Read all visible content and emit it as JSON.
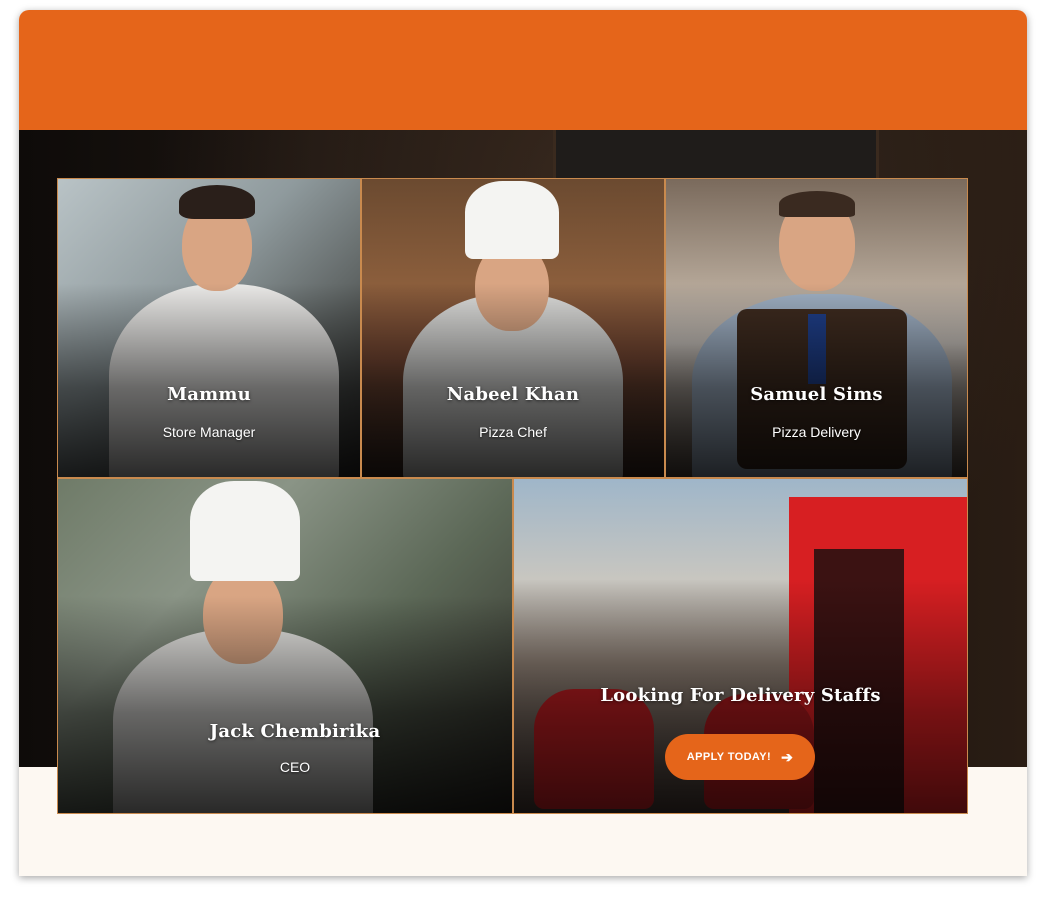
{
  "team": [
    {
      "name": "Mammu",
      "role": "Store Manager"
    },
    {
      "name": "Nabeel Khan",
      "role": "Pizza Chef"
    },
    {
      "name": "Samuel Sims",
      "role": "Pizza Delivery"
    },
    {
      "name": "Jack Chembirika",
      "role": "CEO"
    }
  ],
  "recruit": {
    "title": "Looking For Delivery Staffs",
    "button_label": "APPLY TODAY!",
    "button_icon": "arrow-right-icon"
  },
  "colors": {
    "accent": "#e5651a",
    "cream": "#fdf8f2",
    "dark": "#14100d"
  }
}
